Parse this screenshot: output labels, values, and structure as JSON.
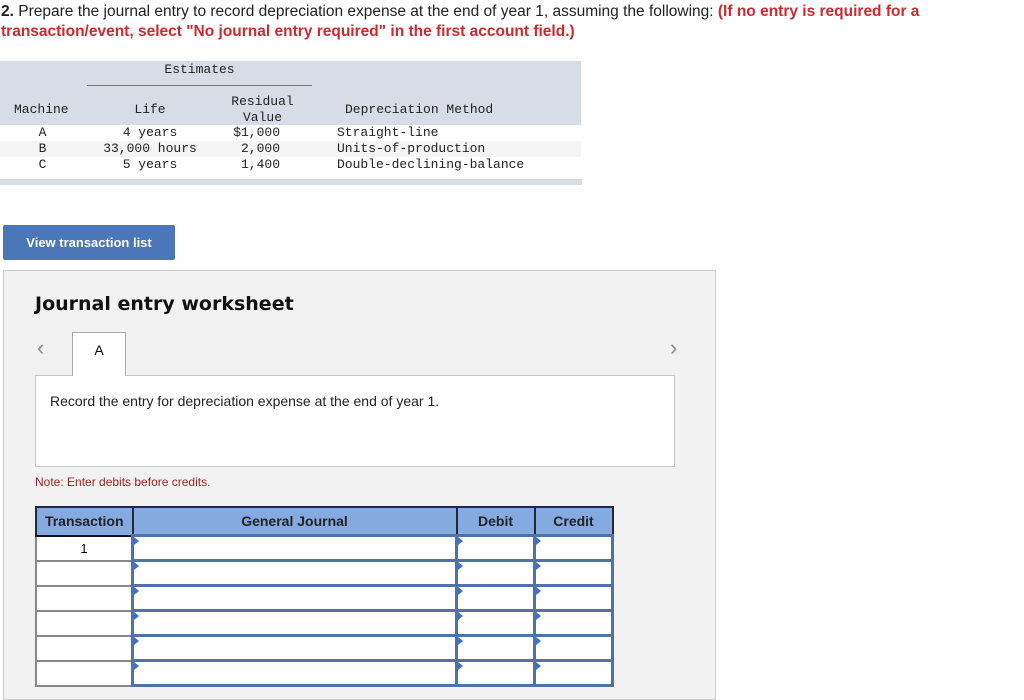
{
  "question": {
    "number": "2.",
    "text": " Prepare the journal entry to record depreciation expense at the end of year 1, assuming the following: ",
    "instruction": "(If no entry is required for a transaction/event, select \"No journal entry required\" in the first account field.)"
  },
  "estimates_table": {
    "group_header": "Estimates",
    "headers": {
      "machine": "Machine",
      "life": "Life",
      "residual_line1": "Residual",
      "residual_line2": "Value",
      "method": "Depreciation Method"
    },
    "rows": [
      {
        "machine": "A",
        "life": "4 years",
        "residual": "$1,000",
        "method": "Straight-line"
      },
      {
        "machine": "B",
        "life": "33,000 hours",
        "residual": "2,000",
        "method": "Units-of-production"
      },
      {
        "machine": "C",
        "life": "5 years",
        "residual": "1,400",
        "method": "Double-declining-balance"
      }
    ]
  },
  "view_button": {
    "label": "View transaction list"
  },
  "worksheet": {
    "title": "Journal entry worksheet",
    "prev_icon": "chevron-left-icon",
    "next_icon": "chevron-right-icon",
    "prev_glyph": "‹",
    "next_glyph": "›",
    "tabs": [
      {
        "label": "A",
        "active": true
      }
    ],
    "description": "Record the entry for depreciation expense at the end of year 1.",
    "note": "Note: Enter debits before credits.",
    "journal": {
      "headers": [
        "Transaction",
        "General Journal",
        "Debit",
        "Credit"
      ],
      "rows": [
        {
          "transaction": "1",
          "account": "",
          "debit": "",
          "credit": ""
        },
        {
          "transaction": "",
          "account": "",
          "debit": "",
          "credit": ""
        },
        {
          "transaction": "",
          "account": "",
          "debit": "",
          "credit": ""
        },
        {
          "transaction": "",
          "account": "",
          "debit": "",
          "credit": ""
        },
        {
          "transaction": "",
          "account": "",
          "debit": "",
          "credit": ""
        },
        {
          "transaction": "",
          "account": "",
          "debit": "",
          "credit": ""
        }
      ]
    }
  },
  "colors": {
    "instruction_red": "#d0282e",
    "button_blue": "#4b77b8",
    "header_blue": "#84aae0",
    "field_border": "#4f72a8",
    "note_red": "#9b2323"
  }
}
